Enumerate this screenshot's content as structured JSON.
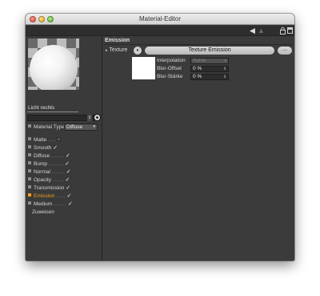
{
  "window": {
    "title": "Material-Editor"
  },
  "left": {
    "material_name": "Licht rechts",
    "material_type_label": "Material Type",
    "material_type_value": "Diffuse",
    "channels": [
      {
        "label": "Matte",
        "dots": "....",
        "checked": false
      },
      {
        "label": "Smooth",
        "dots": "",
        "checked": true
      },
      {
        "label": "Diffuse",
        "dots": ".......",
        "checked": true
      },
      {
        "label": "Bump",
        "dots": "........",
        "checked": true
      },
      {
        "label": "Normal",
        "dots": ".......",
        "checked": true
      },
      {
        "label": "Opacity",
        "dots": "......",
        "checked": true
      },
      {
        "label": "Transmission",
        "dots": "",
        "checked": true
      },
      {
        "label": "Emission",
        "dots": ".....",
        "checked": true,
        "active": true
      },
      {
        "label": "Medium",
        "dots": ".......",
        "checked": true
      }
    ],
    "assign_label": "Zuweisen"
  },
  "right": {
    "section_title": "Emission",
    "texture_label": "Texture",
    "texture_name": "Texture Emission",
    "more_button": "...",
    "props": [
      {
        "label": "Interpolation",
        "value": "Keine",
        "disabled": true
      },
      {
        "label": "Blur-Offset",
        "value": "0 %",
        "disabled": false
      },
      {
        "label": "Blur-Stärke",
        "value": "0 %",
        "disabled": false
      }
    ]
  },
  "icons": {
    "checkmark": "✓",
    "spin": "⇕",
    "dropdown": "▾",
    "toolbar_back": "◀",
    "toolbar_up": "▲"
  }
}
